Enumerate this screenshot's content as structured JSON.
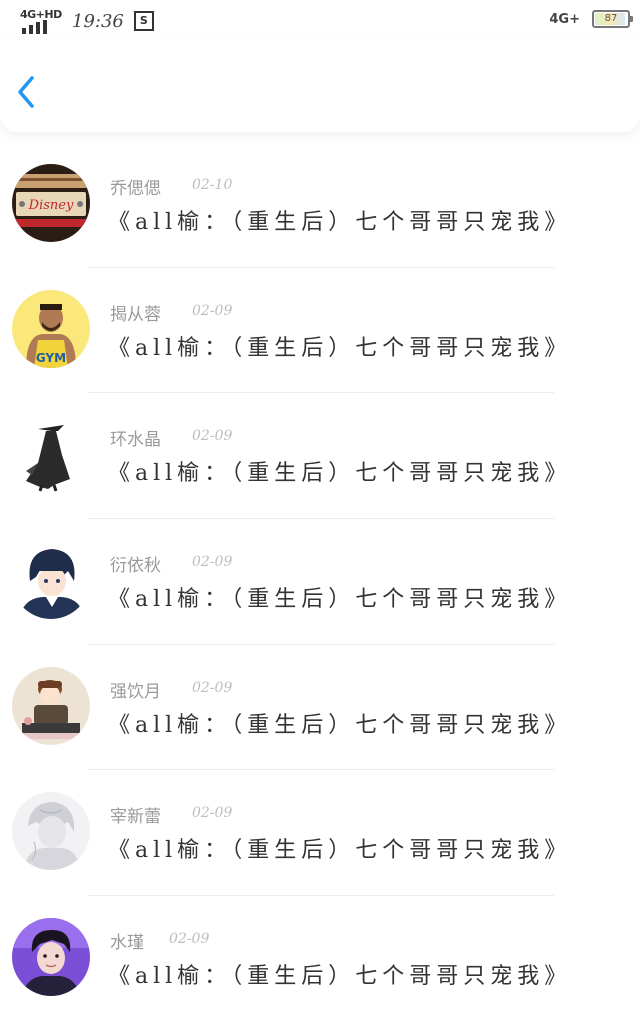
{
  "status_bar": {
    "network_left": "4G+HD",
    "time": "19:36",
    "network_right": "4G+",
    "battery": "87",
    "battery_level": 0.87
  },
  "nav": {
    "back_icon": "chevron-left-icon",
    "accent_color": "#2196f3"
  },
  "comments": [
    {
      "name": "乔偲偲",
      "date": "02-10",
      "title": "《all榆：（重生后）七个哥哥只宠我》",
      "avatar": "disney-sign"
    },
    {
      "name": "揭从蓉",
      "date": "02-09",
      "title": "《all榆：（重生后）七个哥哥只宠我》",
      "avatar": "gym-man"
    },
    {
      "name": "环水晶",
      "date": "02-09",
      "title": "《all榆：（重生后）七个哥哥只宠我》",
      "avatar": "cloaked-figure"
    },
    {
      "name": "衍依秋",
      "date": "02-09",
      "title": "《all榆：（重生后）七个哥哥只宠我》",
      "avatar": "anime-boy"
    },
    {
      "name": "强饮月",
      "date": "02-09",
      "title": "《all榆：（重生后）七个哥哥只宠我》",
      "avatar": "sitting-cartoon"
    },
    {
      "name": "宰新蕾",
      "date": "02-09",
      "title": "《all榆：（重生后）七个哥哥只宠我》",
      "avatar": "sketch-portrait"
    },
    {
      "name": "水瑾",
      "date": "02-09",
      "title": "《all榆：（重生后）七个哥哥只宠我》",
      "avatar": "young-man-photo"
    }
  ]
}
